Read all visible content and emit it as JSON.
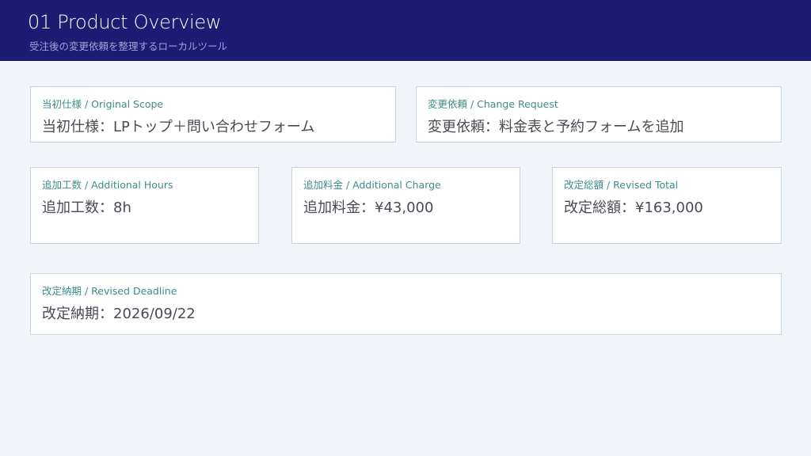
{
  "header": {
    "title": "01 Product Overview",
    "subtitle": "受注後の変更依頼を整理するローカルツール"
  },
  "cards": {
    "original_scope": {
      "label": "当初仕様 / Original Scope",
      "value": "当初仕様：LPトップ＋問い合わせフォーム"
    },
    "change_request": {
      "label": "変更依頼 / Change Request",
      "value": "変更依頼：料金表と予約フォームを追加"
    },
    "additional_hours": {
      "label": "追加工数 / Additional Hours",
      "value": "追加工数：8h"
    },
    "additional_charge": {
      "label": "追加料金 / Additional Charge",
      "value": "追加料金：¥43,000"
    },
    "revised_total": {
      "label": "改定総額 / Revised Total",
      "value": "改定総額：¥163,000"
    },
    "revised_deadline": {
      "label": "改定納期 / Revised Deadline",
      "value": "改定納期：2026/09/22"
    }
  },
  "colors": {
    "header_bg": "#1b1c73",
    "page_bg": "#f1f5fa",
    "label": "#3d8b8a",
    "value": "#4a4a55",
    "card_border": "#c9d4df"
  }
}
